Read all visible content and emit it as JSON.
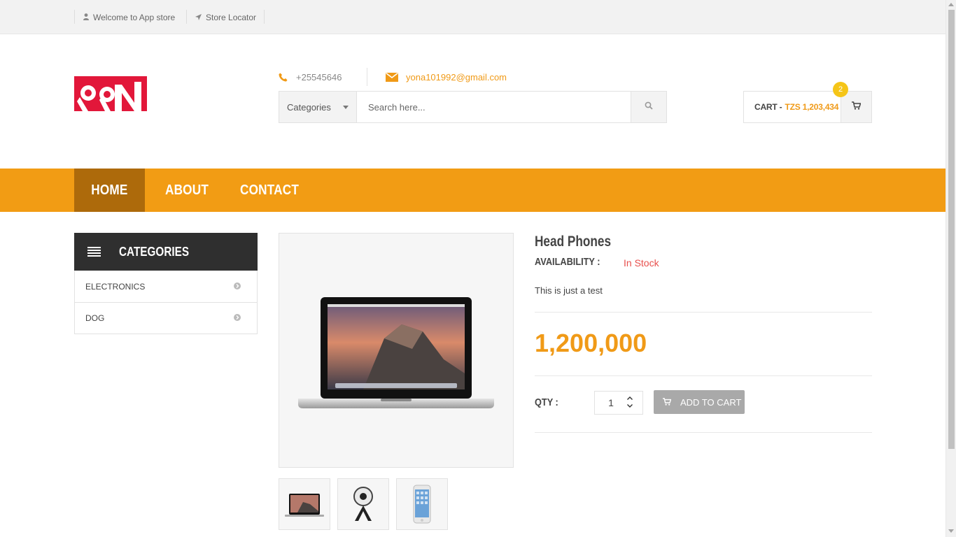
{
  "topbar": {
    "welcome": "Welcome to App store",
    "store_locator": "Store Locator"
  },
  "header": {
    "phone": "+25545646",
    "email": "yona101992@gmail.com",
    "logo_icon": "store-logo"
  },
  "search": {
    "category_label": "Categories",
    "placeholder": "Search here..."
  },
  "cart": {
    "label": "CART -",
    "total": "TZS 1,203,434",
    "count": "2"
  },
  "nav": {
    "items": [
      {
        "label": "HOME",
        "active": true
      },
      {
        "label": "ABOUT",
        "active": false
      },
      {
        "label": "CONTACT",
        "active": false
      }
    ]
  },
  "sidebar": {
    "title": "CATEGORIES",
    "items": [
      {
        "label": "ELECTRONICS"
      },
      {
        "label": "DOG"
      }
    ]
  },
  "product": {
    "title": "Head Phones",
    "availability_label": "AVAILABILITY :",
    "availability_value": "In Stock",
    "description": "This is just a test",
    "price": "1,200,000",
    "qty_label": "QTY :",
    "qty_value": "1",
    "add_to_cart": "ADD TO CART",
    "thumbnails": [
      "laptop",
      "360-camera",
      "smartphone"
    ]
  },
  "colors": {
    "accent": "#f29c14",
    "nav_active": "#ad6a0b",
    "in_stock": "#e8504d",
    "cart_badge": "#f5c518"
  }
}
